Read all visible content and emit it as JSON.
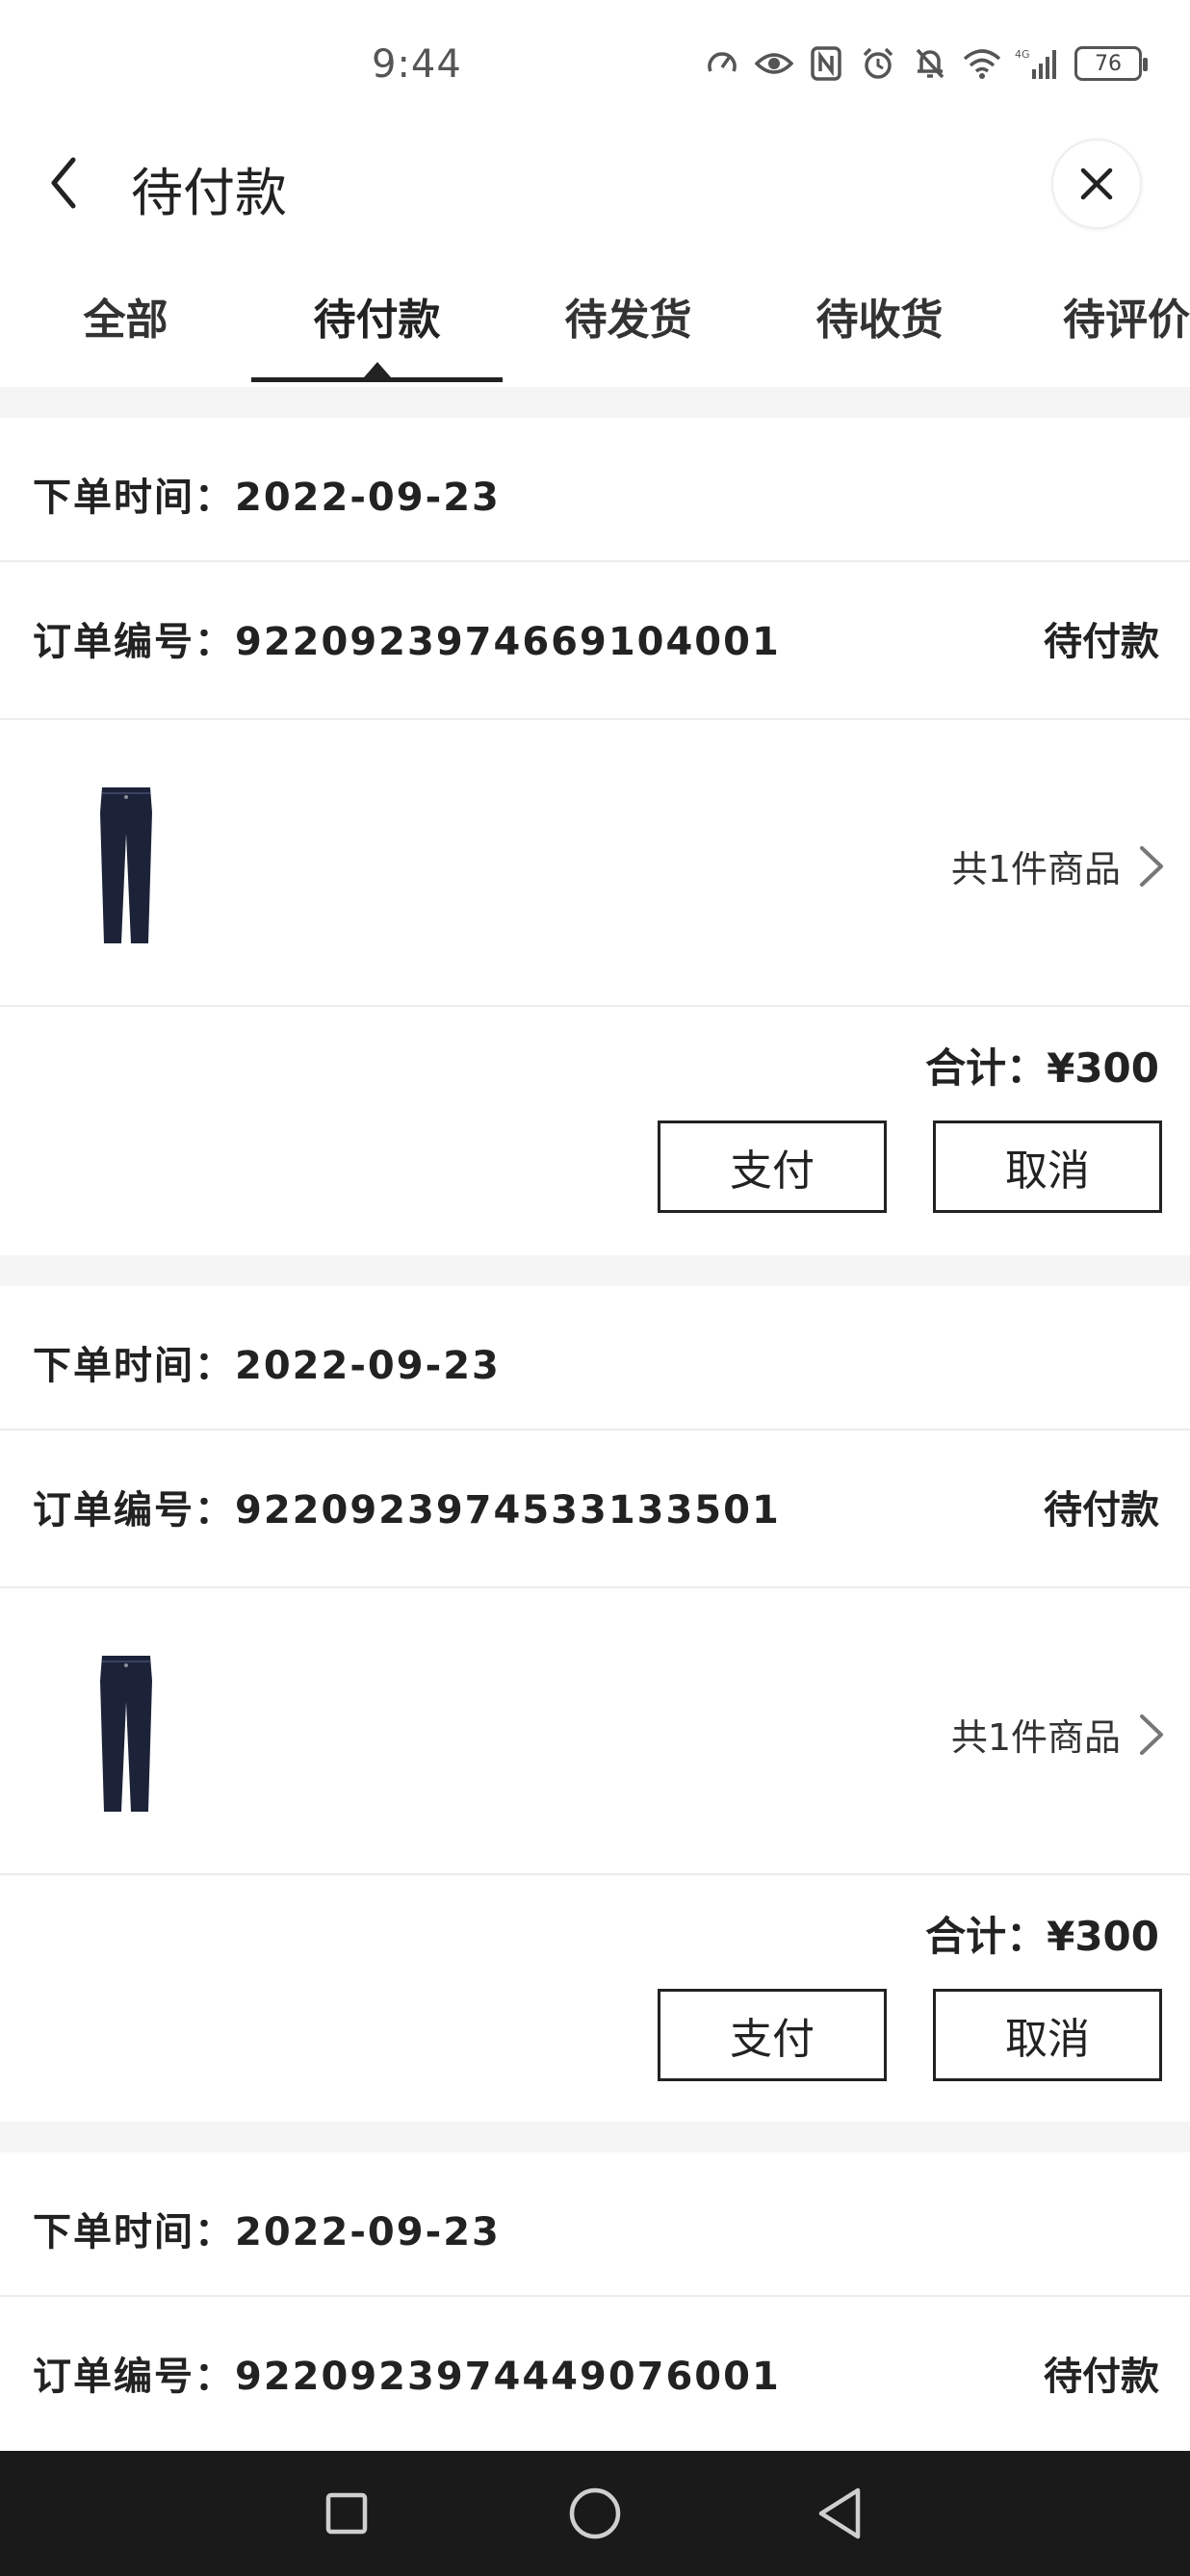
{
  "status_bar": {
    "time": "9:44",
    "icons": [
      "speed-icon",
      "eye-icon",
      "nfc-icon",
      "alarm-icon",
      "mute-bell-icon",
      "wifi-icon",
      "signal-4g-icon"
    ],
    "network": "4G",
    "battery": "76"
  },
  "header": {
    "title": "待付款",
    "back_icon": "chevron-left-icon",
    "close_icon": "close-icon"
  },
  "tabs": [
    {
      "label": "全部",
      "active": false
    },
    {
      "label": "待付款",
      "active": true
    },
    {
      "label": "待发货",
      "active": false
    },
    {
      "label": "待收货",
      "active": false
    },
    {
      "label": "待评价",
      "active": false
    }
  ],
  "orders": [
    {
      "date_label": "下单时间：2022-09-23",
      "order_no_label": "订单编号：9220923974669104001",
      "status": "待付款",
      "item_count": "共1件商品",
      "total": "合计：¥300",
      "pay_label": "支付",
      "cancel_label": "取消"
    },
    {
      "date_label": "下单时间：2022-09-23",
      "order_no_label": "订单编号：9220923974533133501",
      "status": "待付款",
      "item_count": "共1件商品",
      "total": "合计：¥300",
      "pay_label": "支付",
      "cancel_label": "取消"
    },
    {
      "date_label": "下单时间：2022-09-23",
      "order_no_label": "订单编号：9220923974449076001",
      "status": "待付款"
    }
  ],
  "colors": {
    "text": "#222222",
    "divider": "#ececec",
    "band": "#f5f5f5",
    "navbar": "#1a1a1a",
    "jeans": "#1c2238"
  }
}
